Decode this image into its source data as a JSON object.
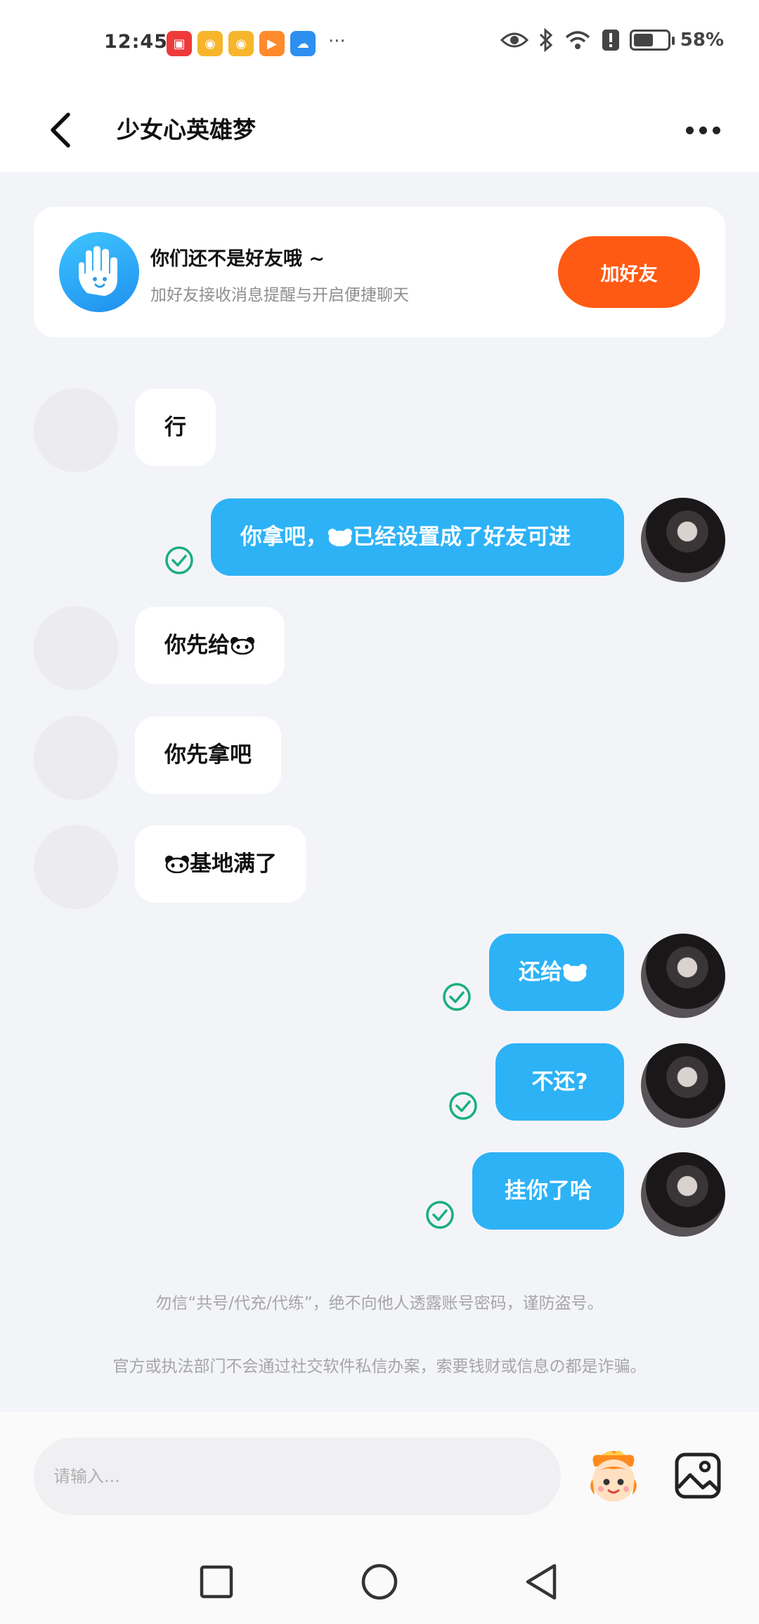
{
  "status_bar": {
    "time": "12:45",
    "battery_pct": "58%",
    "battery_level": 0.58,
    "more": "···"
  },
  "header": {
    "title": "少女心英雄梦"
  },
  "friend_card": {
    "title": "你们还不是好友哦 ~",
    "subtitle": "加好友接收消息提醒与开启便捷聊天",
    "button": "加好友"
  },
  "messages": [
    {
      "from": "them",
      "text": "行"
    },
    {
      "from": "me",
      "text_before": "你拿吧，",
      "text_after": "已经设置成了好友可进",
      "emoji": "panda-emoji"
    },
    {
      "from": "them",
      "text_before": "你先给",
      "text_after": "",
      "emoji": "panda-emoji"
    },
    {
      "from": "them",
      "text": "你先拿吧"
    },
    {
      "from": "them",
      "text_before": "",
      "text_after": "基地满了",
      "emoji": "panda-emoji"
    },
    {
      "from": "me",
      "text_before": "还给",
      "text_after": "",
      "emoji": "panda-emoji"
    },
    {
      "from": "me",
      "text": "不还?"
    },
    {
      "from": "me",
      "text": "挂你了哈"
    }
  ],
  "notices": [
    "勿信“共号/代充/代练”，绝不向他人透露账号密码，谨防盗号。",
    "官方或执法部门不会通过社交软件私信办案，索要钱财或信息の都是诈骗。"
  ],
  "input": {
    "placeholder": "请输入..."
  },
  "colors": {
    "accent_blue": "#2db2f6",
    "add_friend_orange": "#ff5a13",
    "check_green": "#19b07a"
  }
}
